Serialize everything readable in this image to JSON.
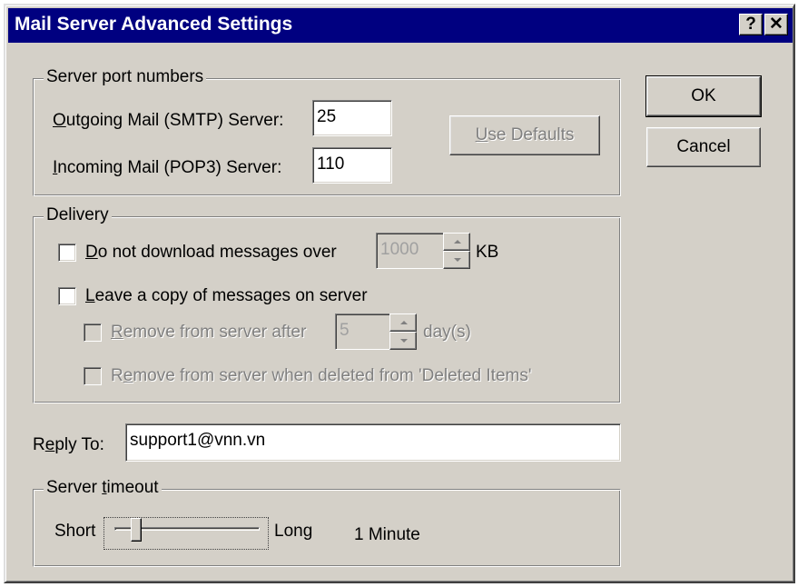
{
  "window": {
    "title": "Mail Server Advanced Settings",
    "help_label": "?",
    "close_label": "✕"
  },
  "buttons": {
    "ok": "OK",
    "cancel": "Cancel",
    "use_defaults": "Use Defaults"
  },
  "server_ports": {
    "legend": "Server port numbers",
    "outgoing_label": "Outgoing Mail (SMTP) Server:",
    "outgoing_value": "25",
    "incoming_label": "Incoming Mail (POP3) Server:",
    "incoming_value": "110"
  },
  "delivery": {
    "legend": "Delivery",
    "no_download_label": "Do not download messages over",
    "no_download_checked": false,
    "size_limit_value": "1000",
    "size_unit": "KB",
    "leave_copy_label": "Leave a copy of messages on server",
    "leave_copy_checked": false,
    "remove_after_label": "Remove from server after",
    "remove_after_checked": false,
    "remove_after_value": "5",
    "remove_after_unit": "day(s)",
    "remove_deleted_label": "Remove from server when deleted from 'Deleted Items'",
    "remove_deleted_checked": false
  },
  "reply_to": {
    "label": "Reply To:",
    "value": "support1@vnn.vn"
  },
  "timeout": {
    "legend": "Server timeout",
    "short_label": "Short",
    "long_label": "Long",
    "value_text": "1 Minute",
    "slider_level": 0.15
  },
  "colors": {
    "titlebar": "#000080",
    "face": "#d4d0c8",
    "disabled_text": "#808080"
  },
  "icons": {
    "help": "question-mark-icon",
    "close": "close-icon"
  }
}
